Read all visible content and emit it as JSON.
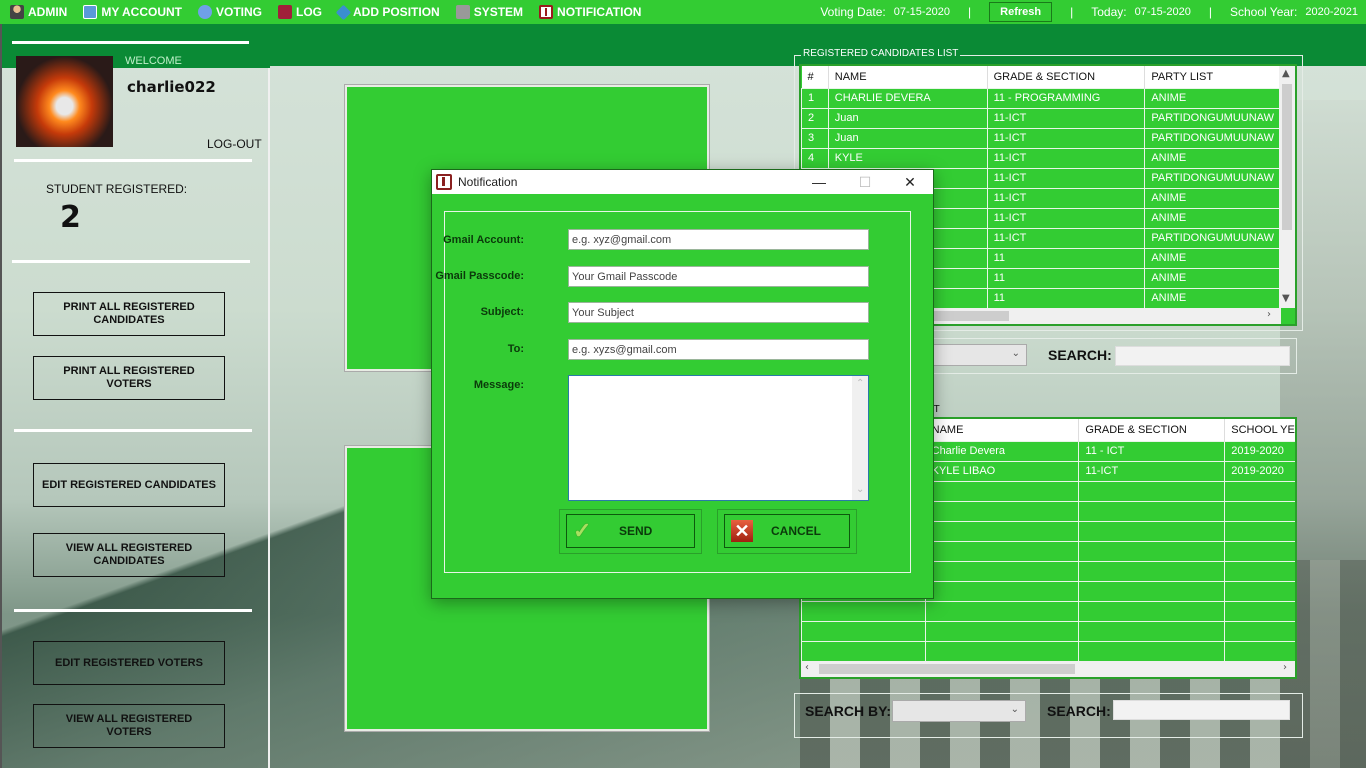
{
  "topbar": {
    "menu": [
      {
        "label": "ADMIN",
        "icon": "admin-icon"
      },
      {
        "label": "MY ACCOUNT",
        "icon": "account-icon"
      },
      {
        "label": "VOTING",
        "icon": "voting-icon"
      },
      {
        "label": "LOG",
        "icon": "log-icon"
      },
      {
        "label": "ADD POSITION",
        "icon": "add-position-icon"
      },
      {
        "label": "SYSTEM",
        "icon": "system-icon"
      },
      {
        "label": "NOTIFICATION",
        "icon": "notification-icon"
      }
    ],
    "voting_date_label": "Voting Date:",
    "voting_date": "07-15-2020",
    "refresh_label": "Refresh",
    "today_label": "Today:",
    "today": "07-15-2020",
    "school_year_label": "School Year:",
    "school_year": "2020-2021",
    "separator": "|",
    "accent_color": "#33cc33"
  },
  "sidebar": {
    "welcome": "WELCOME",
    "username": "charlie022",
    "logout": "LOG-OUT",
    "student_registered_label": "STUDENT REGISTERED:",
    "student_registered_count": "2",
    "buttons": [
      "PRINT ALL REGISTERED CANDIDATES",
      "PRINT ALL REGISTERED VOTERS",
      "EDIT REGISTERED CANDIDATES",
      "VIEW ALL REGISTERED CANDIDATES",
      "EDIT REGISTERED VOTERS",
      "VIEW ALL REGISTERED VOTERS"
    ]
  },
  "candidates": {
    "title": "REGISTERED CANDIDATES LIST",
    "columns": [
      "#",
      "NAME",
      "GRADE & SECTION",
      "PARTY LIST"
    ],
    "rows": [
      [
        "1",
        "CHARLIE DEVERA",
        "11 - PROGRAMMING",
        "ANIME"
      ],
      [
        "2",
        "Juan",
        "11-ICT",
        "PARTIDONGUMUUNAW"
      ],
      [
        "3",
        "Juan",
        "11-ICT",
        "PARTIDONGUMUUNAW"
      ],
      [
        "4",
        "KYLE",
        "11-ICT",
        "ANIME"
      ],
      [
        "",
        "",
        "11-ICT",
        "PARTIDONGUMUUNAW"
      ],
      [
        "",
        "",
        "11-ICT",
        "ANIME"
      ],
      [
        "",
        "",
        "11-ICT",
        "ANIME"
      ],
      [
        "",
        "",
        "11-ICT",
        "PARTIDONGUMUUNAW"
      ],
      [
        "",
        "",
        "11",
        "ANIME"
      ],
      [
        "",
        "",
        "11",
        "ANIME"
      ],
      [
        "",
        "",
        "11",
        "ANIME"
      ]
    ],
    "search_label": "SEARCH:",
    "search_value": ""
  },
  "voters": {
    "title_fragment": "ST",
    "columns": [
      "",
      "NAME",
      "GRADE & SECTION",
      "SCHOOL YEA"
    ],
    "rows": [
      [
        "",
        "Charlie Devera",
        "11 - ICT",
        "2019-2020"
      ],
      [
        "",
        "KYLE LIBAO",
        "11-ICT",
        "2019-2020"
      ]
    ],
    "empty_rows": 9,
    "search_by_label": "SEARCH BY:",
    "search_by_value": "",
    "search_label": "SEARCH:",
    "search_value": ""
  },
  "dialog": {
    "title": "Notification",
    "minimize": "—",
    "maximize": "☐",
    "close": "✕",
    "fields": [
      {
        "label": "Gmail Account:",
        "value": "e.g. xyz@gmail.com"
      },
      {
        "label": "Gmail Passcode:",
        "value": "Your Gmail Passcode"
      },
      {
        "label": "Subject:",
        "value": "Your Subject"
      },
      {
        "label": "To:",
        "value": "e.g. xyzs@gmail.com"
      }
    ],
    "message_label": "Message:",
    "message_value": "",
    "send_label": "SEND",
    "cancel_label": "CANCEL"
  }
}
